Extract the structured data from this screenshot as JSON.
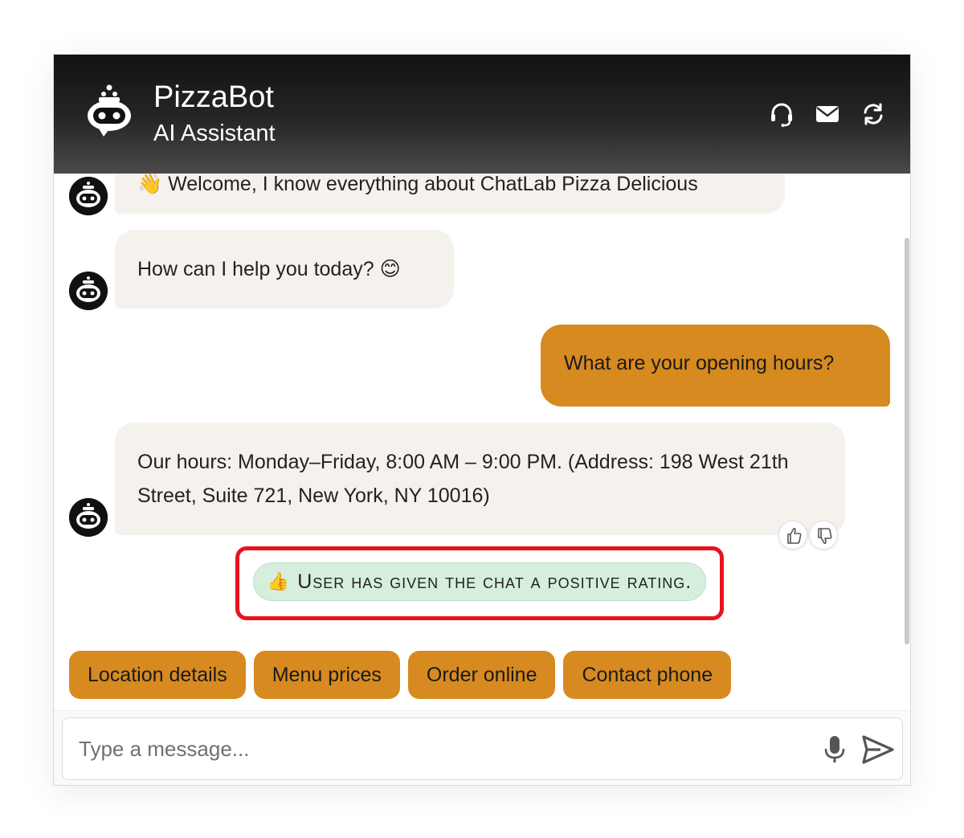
{
  "header": {
    "title": "PizzaBot",
    "subtitle": "AI Assistant",
    "icons": [
      "headset-icon",
      "envelope-icon",
      "refresh-icon"
    ]
  },
  "messages": [
    {
      "sender": "bot",
      "text": "Welcome, I know everything about ChatLab Pizza Delicious",
      "emoji": "👋"
    },
    {
      "sender": "bot",
      "text": "How can I help you today?",
      "emoji": "😊"
    },
    {
      "sender": "user",
      "text": "What are your opening hours?"
    },
    {
      "sender": "bot",
      "text": "Our hours: Monday–Friday, 8:00 AM – 9:00 PM. (Address: 198 West 21th Street, Suite 721, New York, NY 10016)"
    }
  ],
  "rating_notice": {
    "emoji": "👍",
    "text": "User has given the chat a positive rating."
  },
  "quick_replies": [
    "Location details",
    "Menu prices",
    "Order online",
    "Contact phone"
  ],
  "input": {
    "placeholder": "Type a message..."
  },
  "colors": {
    "accent": "#d78a1f",
    "bot_bubble": "#f5f2ee",
    "rating_bg": "#d6efdd",
    "highlight": "#e8141c"
  }
}
